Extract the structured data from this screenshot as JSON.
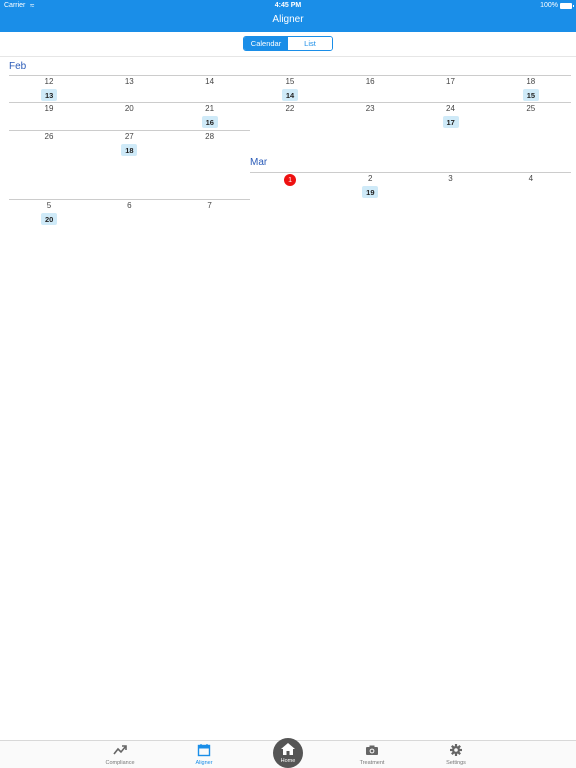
{
  "status_bar": {
    "carrier": "Carrier",
    "time": "4:45 PM",
    "battery": "100%"
  },
  "header": {
    "title": "Aligner"
  },
  "segment": {
    "calendar_label": "Calendar",
    "list_label": "List"
  },
  "calendar": {
    "months": [
      {
        "label": "Feb",
        "weeks": [
          {
            "days": [
              {
                "day": "12",
                "badge": "13"
              },
              {
                "day": "13"
              },
              {
                "day": "14"
              },
              {
                "day": "15",
                "badge": "14"
              },
              {
                "day": "16"
              },
              {
                "day": "17"
              },
              {
                "day": "18",
                "badge": "15"
              }
            ]
          },
          {
            "days": [
              {
                "day": "19"
              },
              {
                "day": "20"
              },
              {
                "day": "21",
                "badge": "16"
              },
              {
                "day": "22"
              },
              {
                "day": "23"
              },
              {
                "day": "24",
                "badge": "17"
              },
              {
                "day": "25"
              }
            ]
          },
          {
            "days": [
              {
                "day": "26"
              },
              {
                "day": "27",
                "badge": "18"
              },
              {
                "day": "28"
              }
            ]
          }
        ]
      },
      {
        "label": "Mar",
        "weeks": [
          {
            "days": [
              {
                "day": "1",
                "today": true
              },
              {
                "day": "2",
                "badge": "19"
              },
              {
                "day": "3"
              },
              {
                "day": "4"
              }
            ]
          },
          {
            "days": [
              {
                "day": "5",
                "badge": "20"
              },
              {
                "day": "6"
              },
              {
                "day": "7"
              }
            ]
          }
        ]
      }
    ]
  },
  "tabbar": {
    "compliance": "Compliance",
    "aligner": "Aligner",
    "home": "Home",
    "treatment": "Treatment",
    "settings": "Settings"
  },
  "colors": {
    "accent": "#1a8ee8",
    "badge_bg": "#cfeaf8",
    "today": "#ee1111",
    "month_label": "#2a5bb8"
  }
}
